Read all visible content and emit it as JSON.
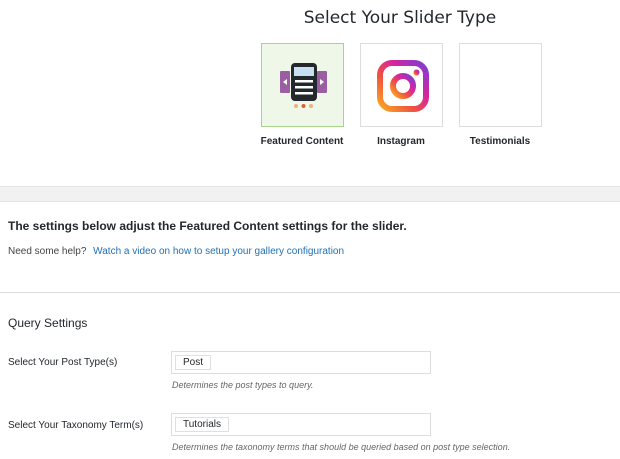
{
  "header": {
    "title": "Select Your Slider Type"
  },
  "slider_types": [
    {
      "label": "Featured Content",
      "icon": "featured-content-slider-icon",
      "selected": true
    },
    {
      "label": "Instagram",
      "icon": "instagram-icon",
      "selected": false
    },
    {
      "label": "Testimonials",
      "icon": "",
      "selected": false
    }
  ],
  "settings": {
    "heading": "The settings below adjust the Featured Content settings for the slider.",
    "help_prefix": "Need some help?",
    "help_link": "Watch a video on how to setup your gallery configuration"
  },
  "query": {
    "title": "Query Settings",
    "fields": [
      {
        "label": "Select Your Post Type(s)",
        "value": "Post",
        "description": "Determines the post types to query."
      },
      {
        "label": "Select Your Taxonomy Term(s)",
        "value": "Tutorials",
        "description": "Determines the taxonomy terms that should be queried based on post type selection."
      }
    ]
  },
  "colors": {
    "accent_link": "#2271b1",
    "selected_border": "#a5d48a",
    "selected_bg": "#eef7e8",
    "icon_purple": "#9b5ea3",
    "icon_dark": "#23282d",
    "icon_blue": "#c8dff2",
    "dot_red": "#e05c3a",
    "dot_orange": "#f0b07a"
  }
}
